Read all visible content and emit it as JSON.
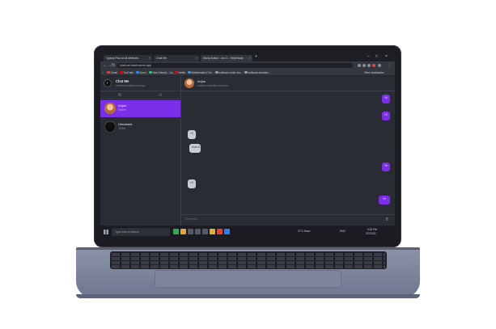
{
  "browser": {
    "tabs": [
      {
        "label": "Typical Plus at all Methods"
      },
      {
        "label": "Chat Me"
      },
      {
        "label": "Study Author - Ion D - Heyendaly"
      }
    ],
    "url": "chat-me-react.vercel.app",
    "bookmarks": [
      {
        "label": "Gmail",
        "color": "#ea4335"
      },
      {
        "label": "YouTube",
        "color": "#ff0000"
      },
      {
        "label": "Zoom",
        "color": "#2d8cff"
      },
      {
        "label": "Send Money - Ca...",
        "color": "#2ecc71"
      },
      {
        "label": "Netflix",
        "color": "#e50914"
      },
      {
        "label": "Mathematics | Fre...",
        "color": "#4a90d9"
      },
      {
        "label": "software under tea...",
        "color": "#999999"
      },
      {
        "label": "software-modules...",
        "color": "#999999"
      }
    ],
    "other_bookmarks": "Other bookmarks"
  },
  "app": {
    "title": "Chat Me",
    "subtitle": "chatme.react@vercel.app",
    "contacts": [
      {
        "name": "Anjou",
        "status": "Online"
      },
      {
        "name": "Unnamed",
        "status": "Offline"
      }
    ],
    "chat": {
      "name": "Anjou",
      "subtitle": "chatme.anjou@vercel.com",
      "messages": [
        {
          "text": "Hi",
          "dir": "out"
        },
        {
          "text": "Hi",
          "dir": "out"
        },
        {
          "text": "Hi",
          "dir": "in"
        },
        {
          "text": "How is",
          "dir": "in"
        },
        {
          "text": "Hi",
          "dir": "out"
        },
        {
          "text": "Hi",
          "dir": "in"
        },
        {
          "text": "Hi",
          "dir": "out"
        }
      ],
      "placeholder": "Type here..."
    }
  },
  "taskbar": {
    "search_placeholder": "Type here to search",
    "tray": "ENG",
    "weather": "27°C  Haze",
    "time": "6:20 PM",
    "date": "3/7/2023"
  },
  "colors": {
    "accent": "#7b2fe8",
    "panel": "#2a2c35"
  }
}
